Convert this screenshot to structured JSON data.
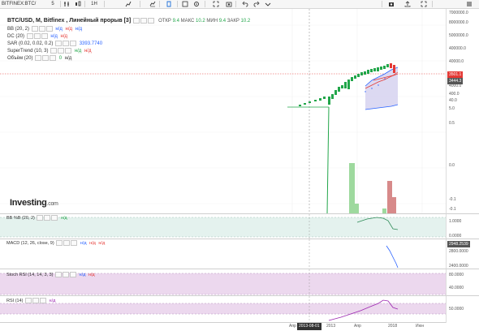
{
  "toolbar": {
    "symbol": "BITFINEX:BTC/",
    "interval": "5",
    "items": [
      "",
      "",
      "1H",
      "",
      "",
      "",
      "",
      "",
      "",
      "",
      "",
      ""
    ]
  },
  "chart": {
    "title": "BTC/USD, M, Bitfinex , Линейный прорыв [3]",
    "ohlc": [
      {
        "k": "ОТКР",
        "v": "9.4"
      },
      {
        "k": "МАКС",
        "v": "10.2"
      },
      {
        "k": "МИН",
        "v": "9.4"
      },
      {
        "k": "ЗАКР",
        "v": "10.2"
      }
    ],
    "indicators": [
      {
        "name": "BB (20, 2)",
        "values": [
          "н/д",
          "н/д",
          "н/д"
        ],
        "colors": [
          "#2962ff",
          "#e53935",
          "#2962ff"
        ]
      },
      {
        "name": "DC (20)",
        "values": [
          "н/д",
          "н/д"
        ],
        "colors": [
          "#2962ff",
          "#e53935"
        ]
      },
      {
        "name": "SAR (0.02, 0.02, 0.2)",
        "values": [
          "3393.7740"
        ],
        "colors": [
          "#2962ff"
        ]
      },
      {
        "name": "SuperTrend (10, 3)",
        "values": [
          "н/д",
          "н/д"
        ],
        "colors": [
          "#22a64a",
          "#e53935"
        ]
      },
      {
        "name": "Объём (20)",
        "values": [
          "0",
          "н/д"
        ],
        "colors": [
          "#22a64a",
          "#333"
        ]
      }
    ],
    "logo_main": "Investing",
    "logo_suffix": ".com",
    "price_labels": [
      "7000000.0",
      "8000000.0",
      "5000000.0",
      "400000.0",
      "40000.0",
      "4000.0",
      "400.0",
      "40.0",
      "5.0",
      "0.5",
      "0.0",
      "-0.1",
      "-0.1"
    ],
    "price_tag_red": "3501.1",
    "price_tag_dark": "3444.3",
    "colors": {
      "up": "#22a64a",
      "down": "#e53935",
      "bb_fill": "#d6d2f0",
      "vol_up": "#9ed99e",
      "vol_down": "#d78a8a"
    }
  },
  "panes": {
    "bb": {
      "label": "BB %B (20, 2)",
      "value": "н/д",
      "value_color": "#22a64a",
      "axis": [
        "1.0000",
        "0.0000"
      ]
    },
    "macd": {
      "label": "MACD (12, 26, close, 9)",
      "values": [
        "н/д",
        "н/д",
        "н/д"
      ],
      "colors": [
        "#2962ff",
        "#e53935",
        "#e53935"
      ],
      "axis": [
        "2800.0000",
        "2400.0000"
      ],
      "tag": "2948.2539"
    },
    "stoch": {
      "label": "Stoch RSI (14, 14, 3, 3)",
      "values": [
        "н/д",
        "н/д"
      ],
      "colors": [
        "#2962ff",
        "#e53935"
      ],
      "axis": [
        "80.0000",
        "40.0000"
      ]
    },
    "rsi": {
      "label": "RSI (14)",
      "value": "н/д",
      "value_color": "#9c27b0",
      "axis": [
        "50.0000"
      ]
    }
  },
  "time_axis": {
    "labels": [
      "Апр",
      "2013",
      "Апр",
      "2018",
      "Июн"
    ],
    "cursor": "2013-08-01"
  }
}
